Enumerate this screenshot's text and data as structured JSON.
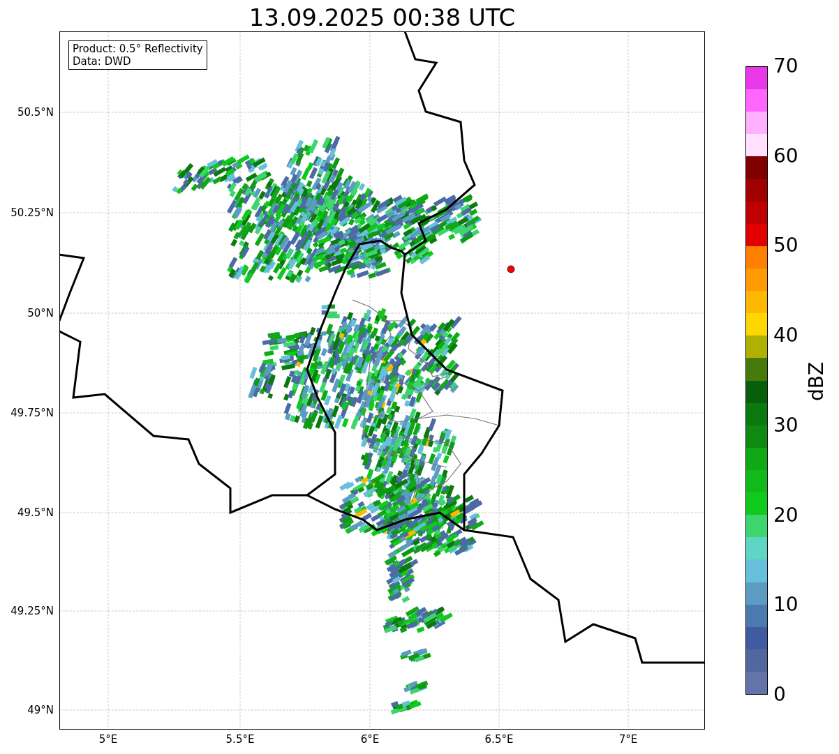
{
  "title": "13.09.2025 00:38 UTC",
  "info_box": {
    "lines": [
      "Product: 0.5° Reflectivity",
      "Data: DWD"
    ]
  },
  "map": {
    "lat_ticks": [
      "50.5°N",
      "50.25°N",
      "50°N",
      "49.75°N",
      "49.5°N",
      "49.25°N",
      "49°N"
    ],
    "lon_ticks": [
      "5°E",
      "5.5°E",
      "6°E",
      "6.5°E",
      "7°E"
    ]
  },
  "colorbar": {
    "label": "dBZ",
    "ticks": [
      "70",
      "60",
      "50",
      "40",
      "30",
      "20",
      "10",
      "0"
    ],
    "colors": [
      {
        "color": "#e838e8"
      },
      {
        "color": "#ff66ff"
      },
      {
        "color": "#ffb0ff"
      },
      {
        "color": "#ffe0ff"
      },
      {
        "color": "#800000"
      },
      {
        "color": "#a00000"
      },
      {
        "color": "#c00000"
      },
      {
        "color": "#e00000"
      },
      {
        "color": "#ff8000"
      },
      {
        "color": "#ff9a00"
      },
      {
        "color": "#ffb800"
      },
      {
        "color": "#ffd700"
      },
      {
        "color": "#b0b000"
      },
      {
        "color": "#467a0a"
      },
      {
        "color": "#085f0b"
      },
      {
        "color": "#0a7a0e"
      },
      {
        "color": "#0e8a10"
      },
      {
        "color": "#10a916"
      },
      {
        "color": "#12b91b"
      },
      {
        "color": "#10c91d"
      },
      {
        "color": "#3dd66e"
      },
      {
        "color": "#5fd6c4"
      },
      {
        "color": "#67c0db"
      },
      {
        "color": "#5b9bc4"
      },
      {
        "color": "#4a7ab0"
      },
      {
        "color": "#405ca0"
      },
      {
        "color": "#52679f"
      },
      {
        "color": "#6574a8"
      }
    ]
  }
}
